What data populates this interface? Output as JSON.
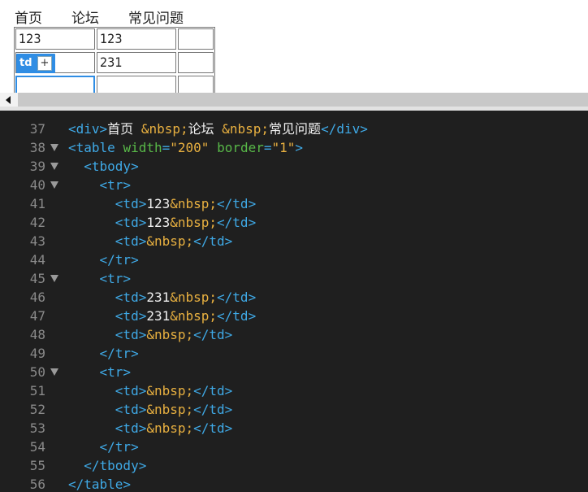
{
  "preview": {
    "nav": [
      "首页",
      "论坛",
      "常见问题"
    ],
    "rows": [
      [
        "123",
        "123",
        ""
      ],
      [
        "",
        "231",
        ""
      ],
      [
        "",
        "",
        ""
      ]
    ],
    "badge": {
      "label": "td",
      "plus": "+"
    }
  },
  "editor": {
    "lines": [
      {
        "num": "37",
        "fold": false,
        "segments": [
          [
            "tag",
            "<div>"
          ],
          [
            "txt",
            "首页 "
          ],
          [
            "ent",
            "&nbsp;"
          ],
          [
            "txt",
            "论坛 "
          ],
          [
            "ent",
            "&nbsp;"
          ],
          [
            "txt",
            "常见问题"
          ],
          [
            "tag",
            "</div>"
          ]
        ]
      },
      {
        "num": "38",
        "fold": true,
        "segments": [
          [
            "tag",
            "<table "
          ],
          [
            "attr",
            "width"
          ],
          [
            "tag",
            "="
          ],
          [
            "str",
            "\"200\""
          ],
          [
            "tag",
            " "
          ],
          [
            "attr",
            "border"
          ],
          [
            "tag",
            "="
          ],
          [
            "str",
            "\"1\""
          ],
          [
            "tag",
            ">"
          ]
        ]
      },
      {
        "num": "39",
        "fold": true,
        "segments": [
          [
            "txt",
            "  "
          ],
          [
            "tag",
            "<tbody>"
          ]
        ]
      },
      {
        "num": "40",
        "fold": true,
        "segments": [
          [
            "txt",
            "    "
          ],
          [
            "tag",
            "<tr>"
          ]
        ]
      },
      {
        "num": "41",
        "fold": false,
        "segments": [
          [
            "txt",
            "      "
          ],
          [
            "tag",
            "<td>"
          ],
          [
            "txt",
            "123"
          ],
          [
            "ent",
            "&nbsp;"
          ],
          [
            "tag",
            "</td>"
          ]
        ]
      },
      {
        "num": "42",
        "fold": false,
        "segments": [
          [
            "txt",
            "      "
          ],
          [
            "tag",
            "<td>"
          ],
          [
            "txt",
            "123"
          ],
          [
            "ent",
            "&nbsp;"
          ],
          [
            "tag",
            "</td>"
          ]
        ]
      },
      {
        "num": "43",
        "fold": false,
        "segments": [
          [
            "txt",
            "      "
          ],
          [
            "tag",
            "<td>"
          ],
          [
            "ent",
            "&nbsp;"
          ],
          [
            "tag",
            "</td>"
          ]
        ]
      },
      {
        "num": "44",
        "fold": false,
        "segments": [
          [
            "txt",
            "    "
          ],
          [
            "tag",
            "</tr>"
          ]
        ]
      },
      {
        "num": "45",
        "fold": true,
        "segments": [
          [
            "txt",
            "    "
          ],
          [
            "tag",
            "<tr>"
          ]
        ]
      },
      {
        "num": "46",
        "fold": false,
        "segments": [
          [
            "txt",
            "      "
          ],
          [
            "tag",
            "<td>"
          ],
          [
            "txt",
            "231"
          ],
          [
            "ent",
            "&nbsp;"
          ],
          [
            "tag",
            "</td>"
          ]
        ]
      },
      {
        "num": "47",
        "fold": false,
        "segments": [
          [
            "txt",
            "      "
          ],
          [
            "tag",
            "<td>"
          ],
          [
            "txt",
            "231"
          ],
          [
            "ent",
            "&nbsp;"
          ],
          [
            "tag",
            "</td>"
          ]
        ]
      },
      {
        "num": "48",
        "fold": false,
        "segments": [
          [
            "txt",
            "      "
          ],
          [
            "tag",
            "<td>"
          ],
          [
            "ent",
            "&nbsp;"
          ],
          [
            "tag",
            "</td>"
          ]
        ]
      },
      {
        "num": "49",
        "fold": false,
        "segments": [
          [
            "txt",
            "    "
          ],
          [
            "tag",
            "</tr>"
          ]
        ]
      },
      {
        "num": "50",
        "fold": true,
        "segments": [
          [
            "txt",
            "    "
          ],
          [
            "tag",
            "<tr>"
          ]
        ]
      },
      {
        "num": "51",
        "fold": false,
        "segments": [
          [
            "txt",
            "      "
          ],
          [
            "tag",
            "<td>"
          ],
          [
            "ent",
            "&nbsp;"
          ],
          [
            "tag",
            "</td>"
          ]
        ]
      },
      {
        "num": "52",
        "fold": false,
        "segments": [
          [
            "txt",
            "      "
          ],
          [
            "tag",
            "<td>"
          ],
          [
            "ent",
            "&nbsp;"
          ],
          [
            "tag",
            "</td>"
          ]
        ]
      },
      {
        "num": "53",
        "fold": false,
        "segments": [
          [
            "txt",
            "      "
          ],
          [
            "tag",
            "<td>"
          ],
          [
            "ent",
            "&nbsp;"
          ],
          [
            "tag",
            "</td>"
          ]
        ]
      },
      {
        "num": "54",
        "fold": false,
        "segments": [
          [
            "txt",
            "    "
          ],
          [
            "tag",
            "</tr>"
          ]
        ]
      },
      {
        "num": "55",
        "fold": false,
        "segments": [
          [
            "txt",
            "  "
          ],
          [
            "tag",
            "</tbody>"
          ]
        ]
      },
      {
        "num": "56",
        "fold": false,
        "segments": [
          [
            "tag",
            "</table>"
          ]
        ]
      }
    ]
  },
  "colors": {
    "editor_background": "#1f1f1f",
    "tag": "#3fa9e6",
    "attribute": "#58b848",
    "string": "#e8b040",
    "selection": "#2f8de4"
  }
}
